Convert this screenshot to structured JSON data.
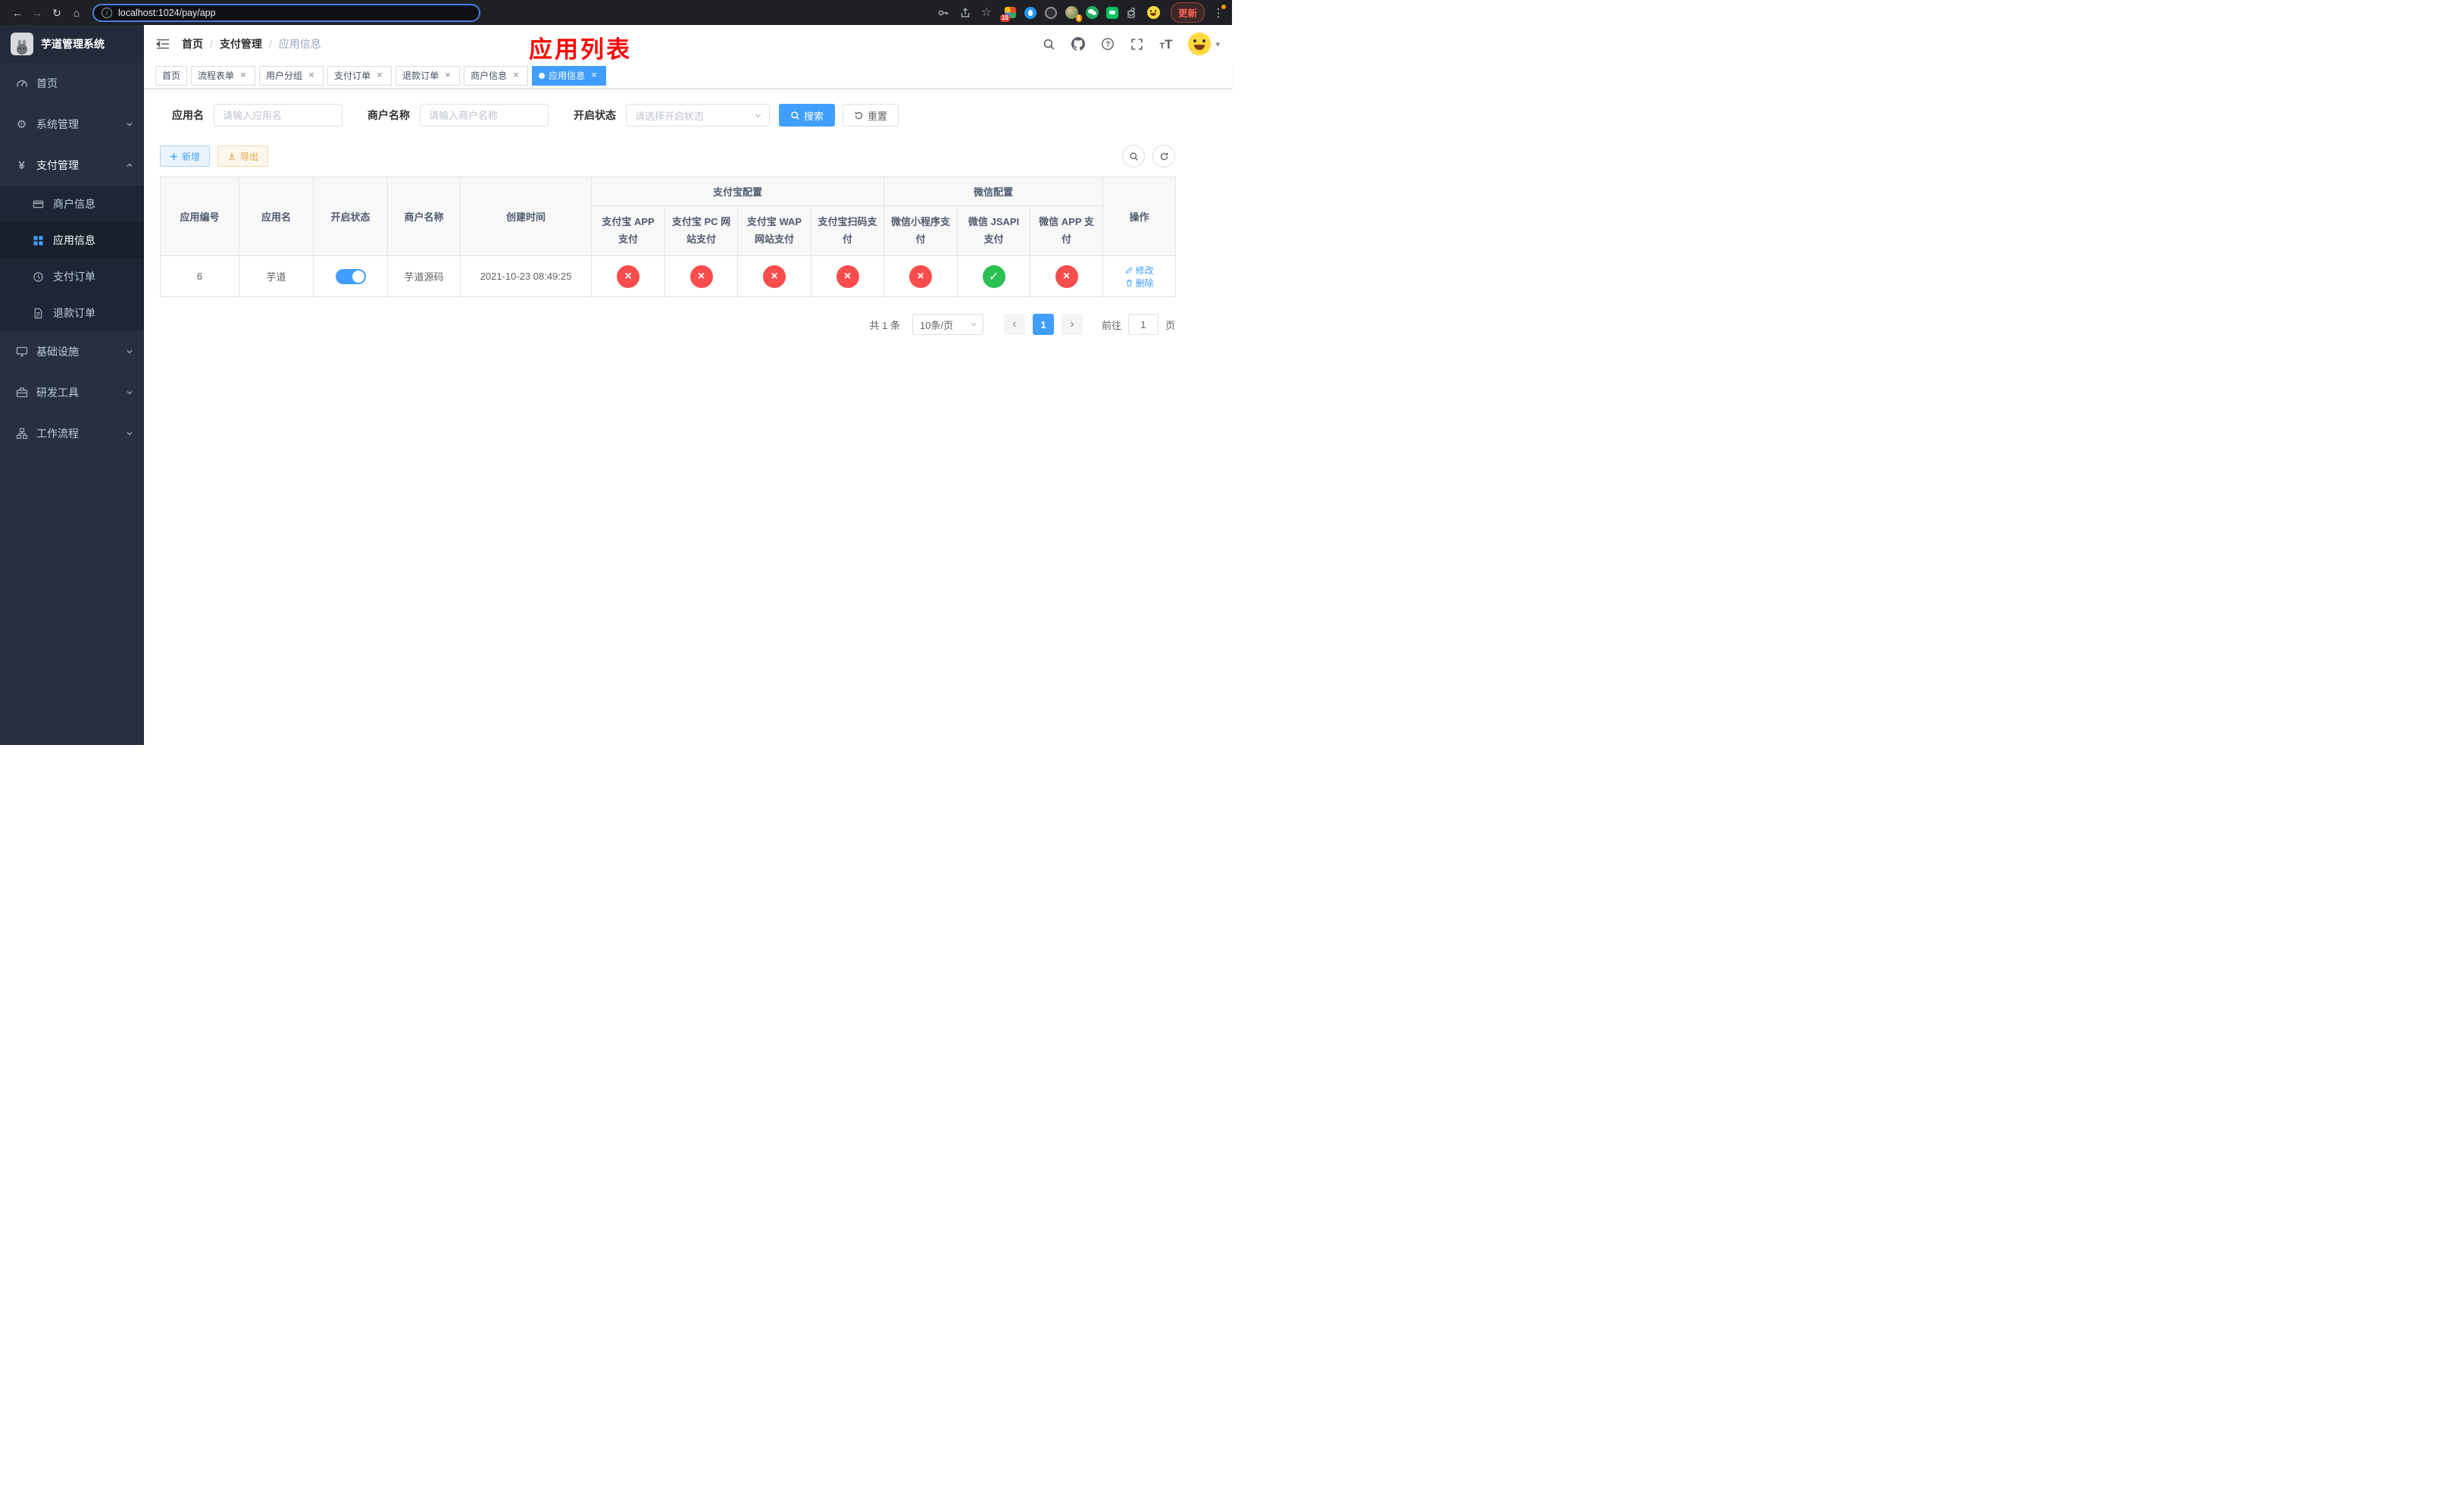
{
  "colors": {
    "primary": "#409EFF",
    "success": "#2bc052",
    "danger": "#f94c4c",
    "warning": "#e6a23c",
    "annotation": "#ff0000",
    "sidebar_bg": "#263040",
    "submenu_bg": "#1d2634"
  },
  "icons": {
    "back": "←",
    "forward": "→",
    "reload": "↻",
    "home": "⌂",
    "star": "☆",
    "gear": "⚙",
    "yen": "¥",
    "dots": "⋮",
    "caret": "▾",
    "close": "×",
    "check": "✓",
    "cross": "×",
    "chevron_left": "‹",
    "chevron_right": "›",
    "question": "?",
    "info": "i",
    "t_small": "T",
    "t_large": "T",
    "plus": "+"
  },
  "browser": {
    "url": "localhost:1024/pay/app",
    "update_label": "更新",
    "extension_badge_count": "10",
    "avatar_badge_count": "1"
  },
  "sidebar": {
    "title": "芋道管理系统",
    "items": [
      {
        "label": "首页"
      },
      {
        "label": "系统管理"
      },
      {
        "label": "支付管理"
      },
      {
        "label": "基础设施"
      },
      {
        "label": "研发工具"
      },
      {
        "label": "工作流程"
      }
    ],
    "payment_children": [
      {
        "label": "商户信息"
      },
      {
        "label": "应用信息"
      },
      {
        "label": "支付订单"
      },
      {
        "label": "退款订单"
      }
    ]
  },
  "navbar": {
    "breadcrumb": [
      "首页",
      "支付管理",
      "应用信息"
    ],
    "separator": "/"
  },
  "annotation": {
    "title": "应用列表"
  },
  "tabs": [
    {
      "label": "首页"
    },
    {
      "label": "流程表单"
    },
    {
      "label": "用户分组"
    },
    {
      "label": "支付订单"
    },
    {
      "label": "退款订单"
    },
    {
      "label": "商户信息"
    },
    {
      "label": "应用信息"
    }
  ],
  "filters": {
    "app_name_label": "应用名",
    "app_name_placeholder": "请输入应用名",
    "merchant_label": "商户名称",
    "merchant_placeholder": "请输入商户名称",
    "status_label": "开启状态",
    "status_placeholder": "请选择开启状态",
    "search_label": "搜索",
    "reset_label": "重置"
  },
  "toolbar": {
    "add_label": "新增",
    "export_label": "导出"
  },
  "table": {
    "groups": {
      "alipay": "支付宝配置",
      "wechat": "微信配置"
    },
    "columns": {
      "id": "应用编号",
      "name": "应用名",
      "status": "开启状态",
      "merchant": "商户名称",
      "created": "创建时间",
      "alipay_app": "支付宝 APP 支付",
      "alipay_pc": "支付宝 PC 网站支付",
      "alipay_wap": "支付宝 WAP 网站支付",
      "alipay_qr": "支付宝扫码支付",
      "wx_mini": "微信小程序支付",
      "wx_jsapi": "微信 JSAPI 支付",
      "wx_app": "微信 APP 支付",
      "actions": "操作"
    },
    "rows": [
      {
        "id": "6",
        "name": "芋道",
        "enabled": true,
        "merchant": "芋道源码",
        "created": "2021-10-23 08:49:25",
        "statuses": {
          "alipay_app": false,
          "alipay_pc": false,
          "alipay_wap": false,
          "alipay_qr": false,
          "wx_mini": false,
          "wx_jsapi": true,
          "wx_app": false
        },
        "edit_label": "修改",
        "delete_label": "删除"
      }
    ]
  },
  "pagination": {
    "total": "共 1 条",
    "page_size": "10条/页",
    "page": "1",
    "goto_label": "前往",
    "goto_value": "1",
    "page_unit": "页"
  }
}
